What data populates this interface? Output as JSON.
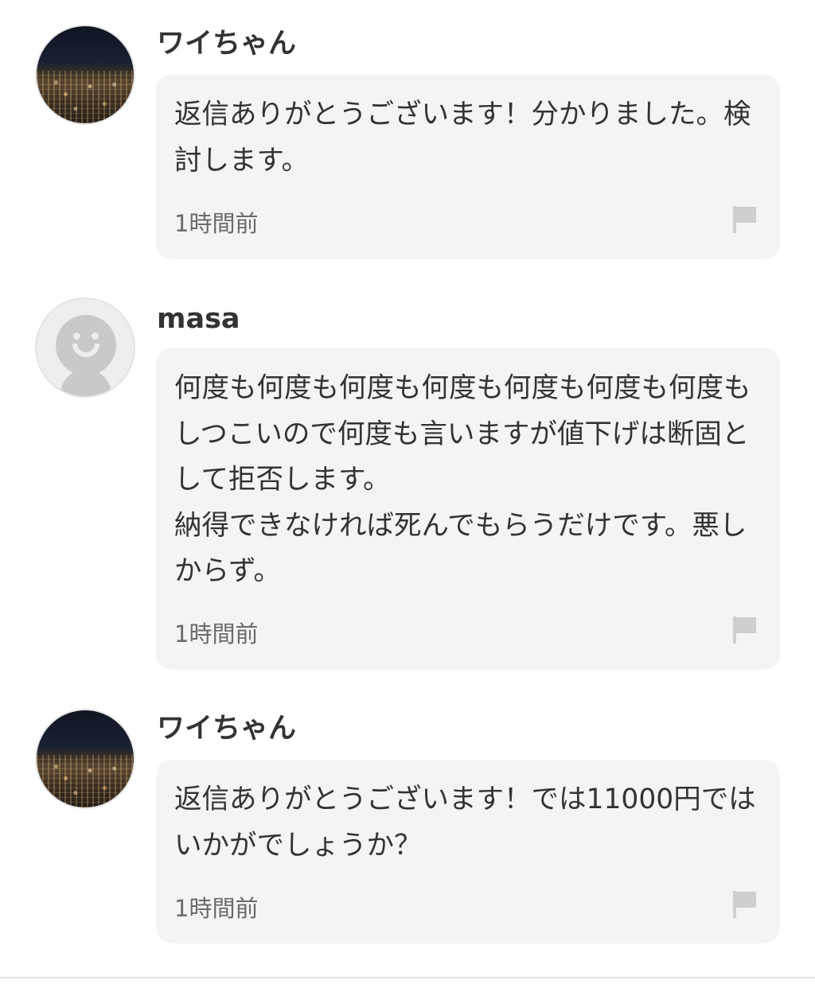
{
  "comments": [
    {
      "username": "ワイちゃん",
      "avatar": "night-city-photo",
      "message": "返信ありがとうございます！分かりました。検討します。",
      "time": "1時間前",
      "flag_icon": "flag-icon"
    },
    {
      "username": "masa",
      "avatar": "default-user-icon",
      "message": "何度も何度も何度も何度も何度も何度も何度もしつこいので何度も言いますが値下げは断固として拒否します。\n納得できなければ死んでもらうだけです。悪しからず。",
      "time": "1時間前",
      "flag_icon": "flag-icon"
    },
    {
      "username": "ワイちゃん",
      "avatar": "night-city-photo",
      "message": "返信ありがとうございます！では11000円ではいかがでしょうか？",
      "time": "1時間前",
      "flag_icon": "flag-icon"
    }
  ],
  "colors": {
    "bubble_background": "#f4f4f4",
    "text": "#333333",
    "timestamp": "#6a6a6a",
    "flag": "#cfcfcf",
    "default_avatar": "#c9c9c9"
  }
}
